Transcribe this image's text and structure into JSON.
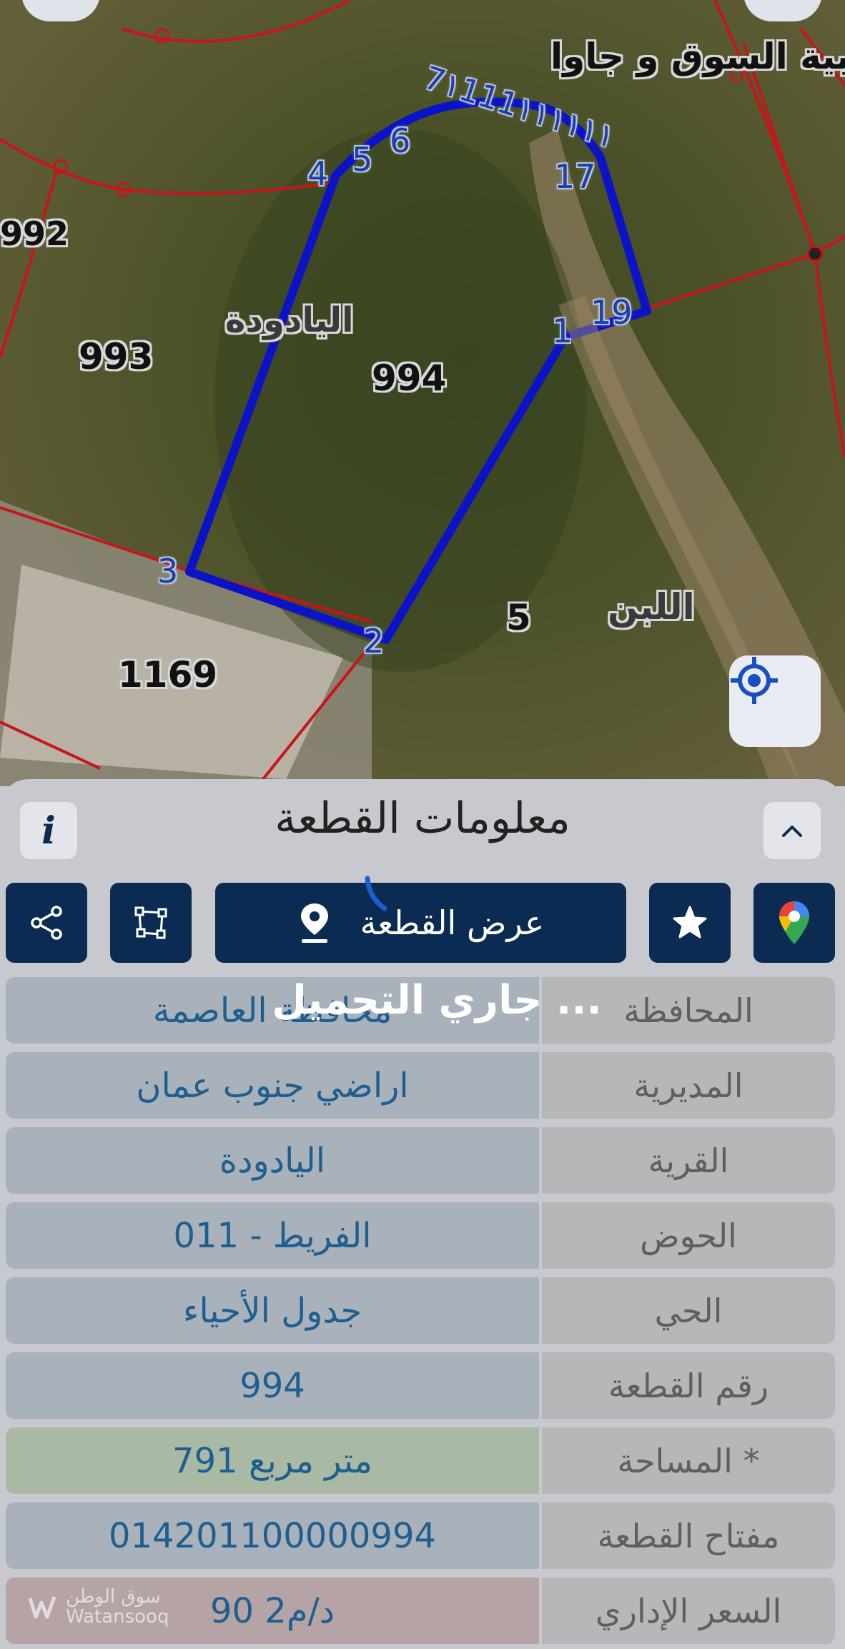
{
  "map": {
    "parcel_labels": [
      "992",
      "993",
      "994",
      "1169",
      "5"
    ],
    "place_labels": [
      "غربية السوق و جاوا",
      "اليادودة",
      "اللبن"
    ],
    "vertex_labels": [
      "1",
      "2",
      "3",
      "4",
      "5",
      "6",
      "17",
      "19"
    ],
    "vertex_cluster": "7١111١١١١١١"
  },
  "sheet": {
    "title": "معلومات القطعة",
    "info_label": "i",
    "show_parcel_label": "عرض القطعة",
    "loading_text": "جاري التحميل ..."
  },
  "details": [
    {
      "key": "المحافظة",
      "value": "محافظة العاصمة"
    },
    {
      "key": "المديرية",
      "value": "اراضي جنوب عمان"
    },
    {
      "key": "القرية",
      "value": "اليادودة"
    },
    {
      "key": "الحوض",
      "value": "الفريط - 011"
    },
    {
      "key": "الحي",
      "value": "جدول الأحياء"
    },
    {
      "key": "رقم القطعة",
      "value": "994"
    },
    {
      "key": "المساحة *",
      "value": "791  متر مربع"
    },
    {
      "key": "مفتاح القطعة",
      "value": "014201100000994"
    },
    {
      "key": "السعر الإداري",
      "value": "90 د/م2"
    }
  ],
  "watermark": {
    "arabic": "سوق الوطن",
    "latin": "Watansooq"
  },
  "colors": {
    "parcel_outline": "#0b12c8",
    "boundary_lines": "#c8141a",
    "action_buttons": "#0b2b52",
    "value_text": "#1f5f8f"
  },
  "icons": [
    "share-icon",
    "polygon-icon",
    "location-pin-icon",
    "star-icon",
    "google-maps-icon",
    "gps-locate-icon",
    "chevron-up-icon"
  ]
}
